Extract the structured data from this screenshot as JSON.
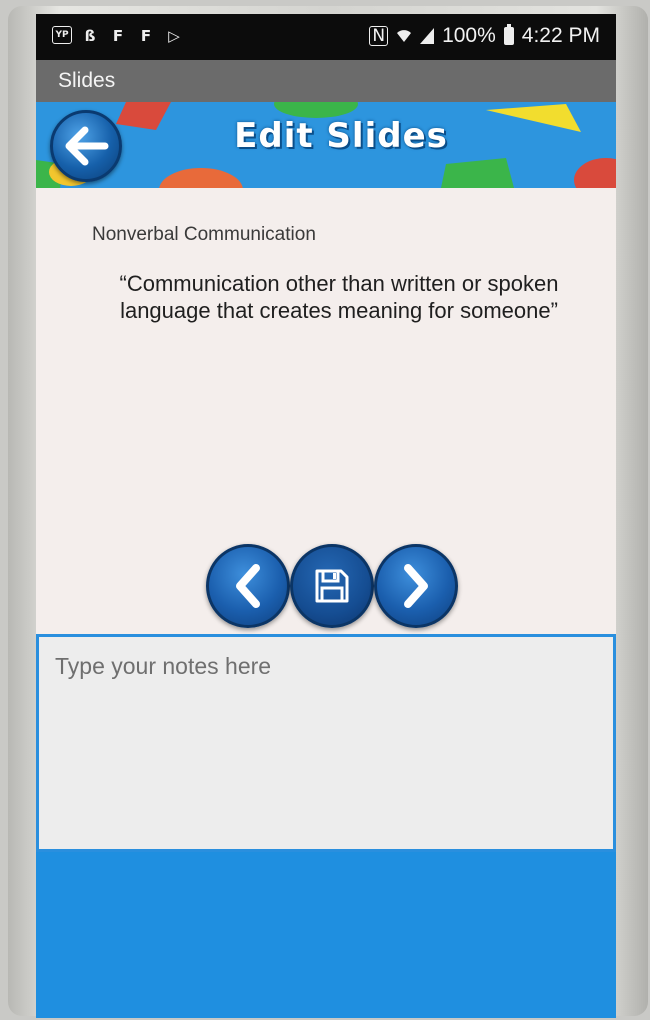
{
  "status_bar": {
    "left_icons": [
      "yp-app-icon",
      "s-app-icon",
      "flipboard-icon",
      "flipboard-icon",
      "play-store-icon"
    ],
    "nfc_label": "N",
    "battery": "100%",
    "time": "4:22 PM"
  },
  "app": {
    "title": "Slides"
  },
  "header": {
    "title": "Edit Slides",
    "back_icon": "back-arrow-icon"
  },
  "slide": {
    "heading": "Nonverbal Communication",
    "body": "“Communication other than written or spoken language that creates meaning for someone”"
  },
  "nav": {
    "prev_icon": "chevron-left-icon",
    "save_icon": "floppy-disk-icon",
    "next_icon": "chevron-right-icon"
  },
  "notes": {
    "placeholder": "Type your notes here",
    "value": ""
  },
  "colors": {
    "accent_blue": "#1f8fe0",
    "button_blue": "#1b5fae",
    "slide_background": "#f4eeec",
    "titlebar_gray": "#6b6b6b"
  }
}
